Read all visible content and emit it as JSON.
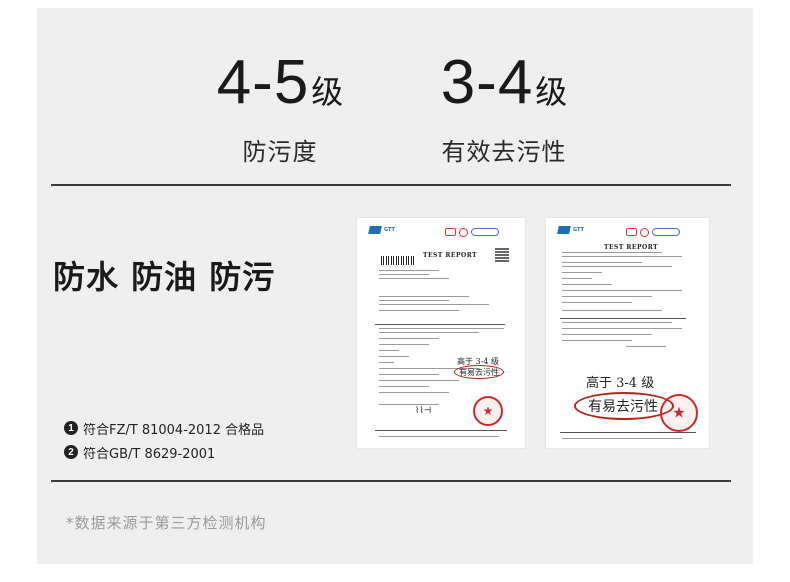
{
  "ratings": [
    {
      "number": "4-5",
      "unit": "级",
      "caption": "防污度"
    },
    {
      "number": "3-4",
      "unit": "级",
      "caption": "有效去污性"
    }
  ],
  "headline": "防水 防油 防污",
  "certifications": [
    {
      "index": "1",
      "text": "符合FZ/T 81004-2012 合格品"
    },
    {
      "index": "2",
      "text": "符合GB/T 8629-2001"
    }
  ],
  "footnote": "*数据来源于第三方检测机构",
  "reports": [
    {
      "title": "TEST REPORT",
      "annotation_top": "高于 3-4 级",
      "annotation_circled": "有易去污性"
    },
    {
      "title": "TEST REPORT",
      "annotation_top": "高于 3-4 级",
      "annotation_circled": "有易去污性"
    }
  ],
  "colors": {
    "panel": "#efefef",
    "rule": "#3a3a3a",
    "seal": "#cc2a2a",
    "logo": "#1d6fb8",
    "footnote": "#9a9a9a"
  }
}
